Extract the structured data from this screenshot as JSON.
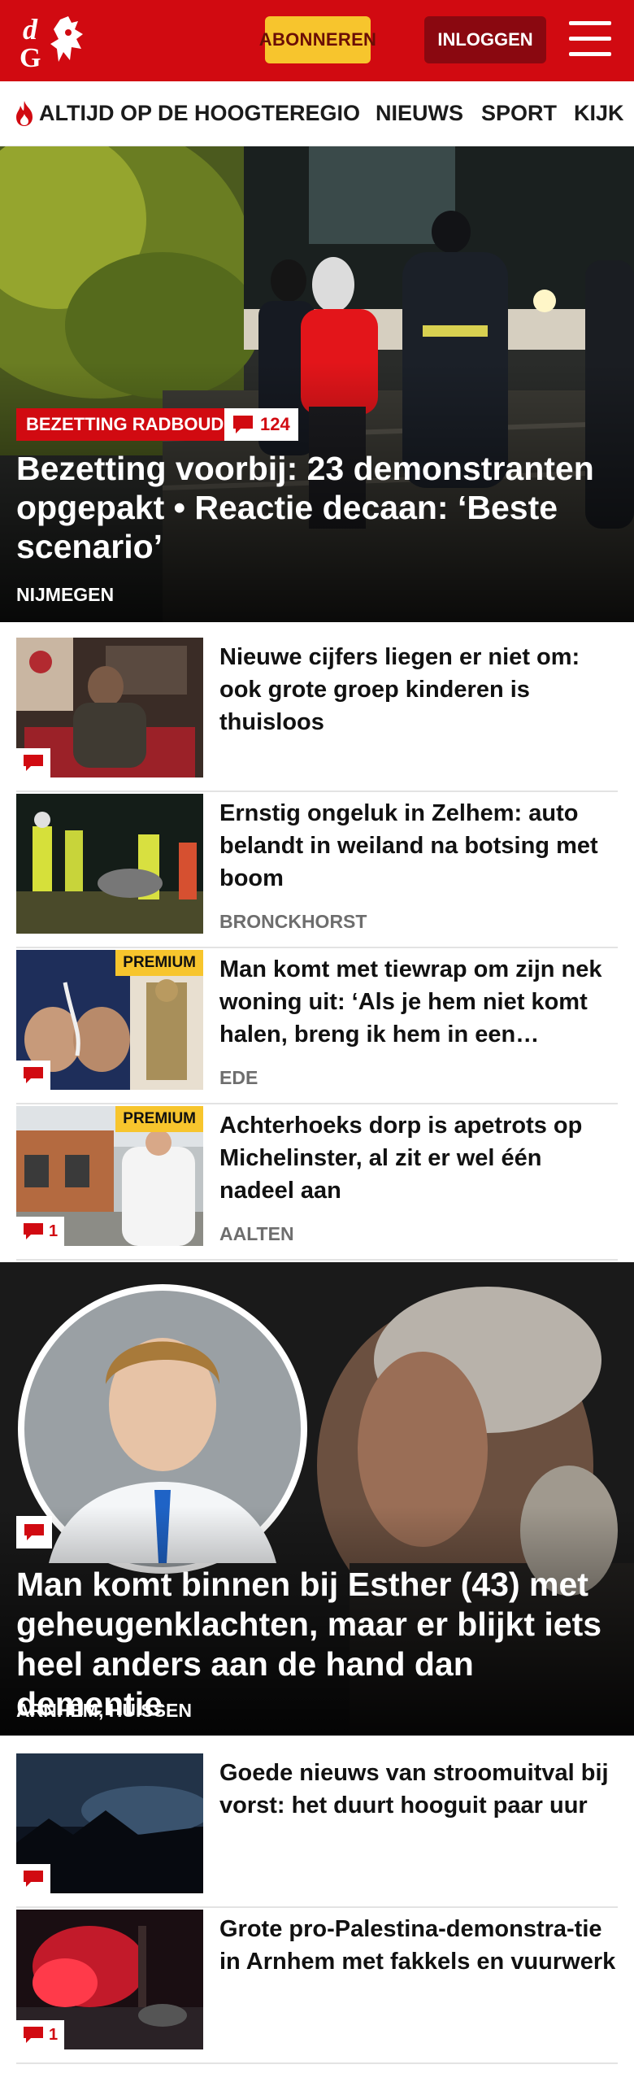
{
  "header": {
    "subscribe_label": "ABONNEREN",
    "login_label": "INLOGGEN",
    "brand_color": "#d10a11",
    "subscribe_color": "#f7c52d"
  },
  "nav": {
    "items": [
      {
        "label": "ALTIJD OP DE HOOGTE",
        "icon": "flame-icon"
      },
      {
        "label": "REGIO"
      },
      {
        "label": "NIEUWS"
      },
      {
        "label": "SPORT"
      },
      {
        "label": "KIJK"
      }
    ]
  },
  "hero": {
    "tag": "BEZETTING RADBOUD",
    "comments": "124",
    "title": "Bezetting voorbij: 23 demonstranten opgepakt • Reactie decaan: ‘Beste scenario’",
    "location": "NIJMEGEN"
  },
  "articles": [
    {
      "title": "Nieuwe cijfers liegen er niet om: ook grote groep kinderen is thuisloos",
      "location": "",
      "premium": "",
      "comments": "",
      "has_comment_icon": true
    },
    {
      "title": "Ernstig ongeluk in Zelhem: auto belandt in weiland na botsing met boom",
      "location": "BRONCKHORST",
      "premium": "",
      "comments": "",
      "has_comment_icon": false
    },
    {
      "title": "Man komt met tiewrap om zijn nek woning uit: ‘Als je hem niet komt halen, breng ik hem in een…",
      "location": "EDE",
      "premium": "PREMIUM",
      "comments": "",
      "has_comment_icon": true
    },
    {
      "title": "Achterhoeks dorp is apetrots op Michelinster, al zit er wel één nadeel aan",
      "location": "AALTEN",
      "premium": "PREMIUM",
      "comments": "1",
      "has_comment_icon": true
    }
  ],
  "feature": {
    "title": "Man komt binnen bij Esther (43) met geheugenklachten, maar er blijkt iets heel anders aan de hand dan dementie",
    "location": "ARNHEM, HUISSEN"
  },
  "articles_2": [
    {
      "title": "Goede nieuws van stroomuitval bij vorst: het duurt hooguit paar uur",
      "location": "",
      "comments": "",
      "has_comment_icon": true
    },
    {
      "title": "Grote pro-Palestina-demonstra-tie in Arnhem met fakkels en vuurwerk",
      "location": "",
      "comments": "1",
      "has_comment_icon": true
    }
  ]
}
